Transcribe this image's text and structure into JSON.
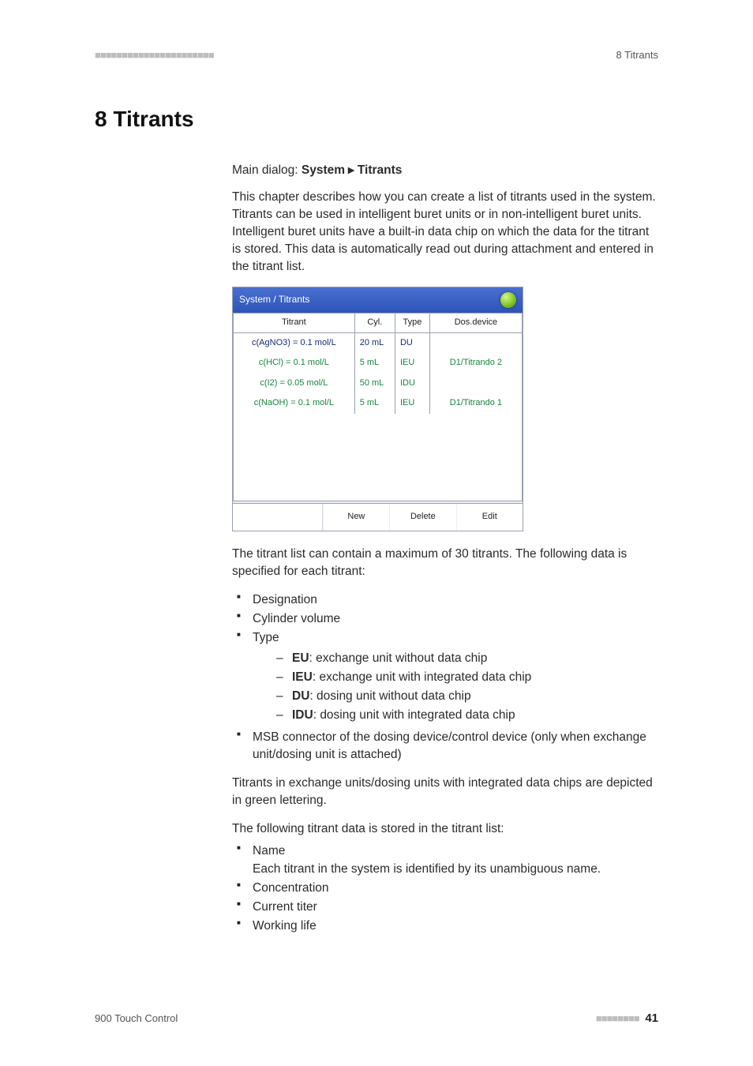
{
  "header": {
    "dashes": "■■■■■■■■■■■■■■■■■■■■■■",
    "section_label": "8 Titrants"
  },
  "title": "8   Titrants",
  "breadcrumb": {
    "prefix": "Main dialog: ",
    "part1": "System",
    "arrow": "▸",
    "part2": "Titrants"
  },
  "intro": "This chapter describes how you can create a list of titrants used in the system. Titrants can be used in intelligent buret units or in non-intelligent buret units. Intelligent buret units have a built-in data chip on which the data for the titrant is stored. This data is automatically read out during attachment and entered in the titrant list.",
  "screenshot": {
    "title": "System / Titrants",
    "columns": {
      "c1": "Titrant",
      "c2": "Cyl.",
      "c3": "Type",
      "c4": "Dos.device"
    },
    "rows": [
      {
        "titrant": "c(AgNO3) = 0.1 mol/L",
        "cyl": "20 mL",
        "type": "DU",
        "dev": "",
        "chip": false
      },
      {
        "titrant": "c(HCl) = 0.1 mol/L",
        "cyl": "5 mL",
        "type": "IEU",
        "dev": "D1/Titrando 2",
        "chip": true
      },
      {
        "titrant": "c(I2) = 0.05 mol/L",
        "cyl": "50 mL",
        "type": "IDU",
        "dev": "",
        "chip": true
      },
      {
        "titrant": "c(NaOH) = 0.1 mol/L",
        "cyl": "5 mL",
        "type": "IEU",
        "dev": "D1/Titrando 1",
        "chip": true
      }
    ],
    "buttons": {
      "new": "New",
      "delete": "Delete",
      "edit": "Edit"
    }
  },
  "after_shot": "The titrant list can contain a maximum of 30 titrants. The following data is specified for each titrant:",
  "list1": {
    "i1": "Designation",
    "i2": "Cylinder volume",
    "i3": "Type",
    "sub": {
      "s1b": "EU",
      "s1t": ": exchange unit without data chip",
      "s2b": "IEU",
      "s2t": ": exchange unit with integrated data chip",
      "s3b": "DU",
      "s3t": ": dosing unit without data chip",
      "s4b": "IDU",
      "s4t": ": dosing unit with integrated data chip"
    },
    "i4": "MSB connector of the dosing device/control device (only when exchange unit/dosing unit is attached)"
  },
  "para_green": "Titrants in exchange units/dosing units with integrated data chips are depicted in green lettering.",
  "para_stored": "The following titrant data is stored in the titrant list:",
  "list2": {
    "i1": "Name",
    "i1_sub": "Each titrant in the system is identified by its unambiguous name.",
    "i2": "Concentration",
    "i3": "Current titer",
    "i4": "Working life"
  },
  "footer": {
    "product": "900 Touch Control",
    "dashes": "■■■■■■■■",
    "page": "41"
  }
}
